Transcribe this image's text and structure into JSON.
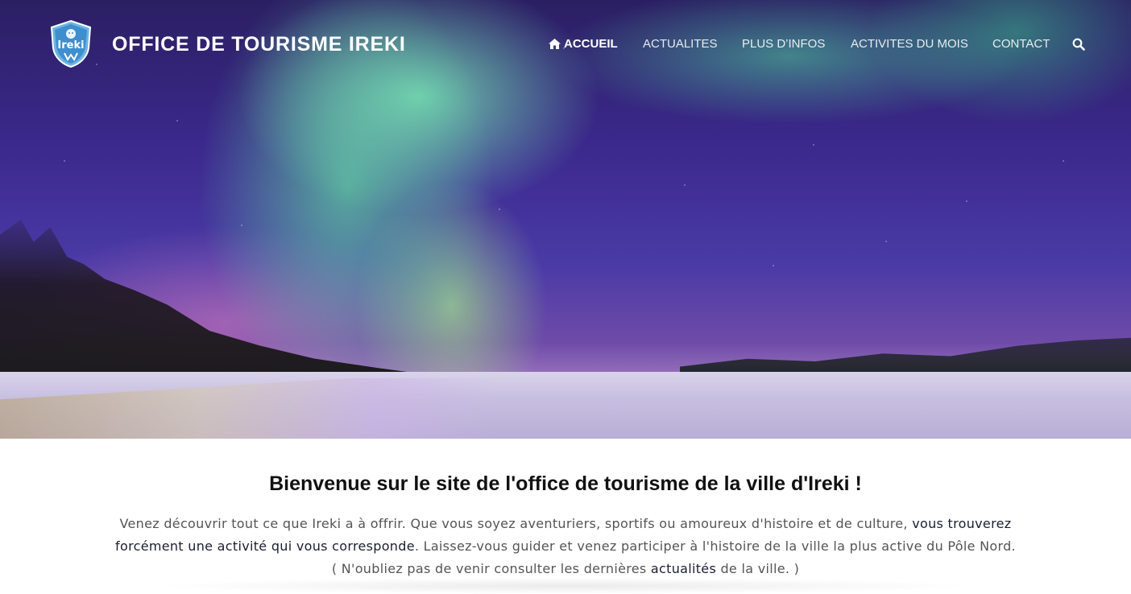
{
  "header": {
    "logo_text": "Ireki",
    "site_title": "OFFICE DE TOURISME IREKI"
  },
  "nav": {
    "items": [
      {
        "label": "ACCUEIL",
        "icon": "home-icon",
        "active": true
      },
      {
        "label": "ACTUALITES",
        "active": false
      },
      {
        "label": "PLUS D’INFOS",
        "active": false
      },
      {
        "label": "ACTIVITES DU MOIS",
        "active": false
      },
      {
        "label": "CONTACT",
        "active": false
      }
    ],
    "search_icon": "search-icon"
  },
  "hero": {
    "image": "aurora-borealis-snowy-landscape"
  },
  "main": {
    "title": "Bienvenue sur le site de l'office de tourisme de la ville d'Ireki !",
    "intro_part1": "Venez découvrir tout ce que Ireki a à offrir. Que vous soyez aventuriers, sportifs ou amoureux d'histoire et de culture, ",
    "intro_highlight": "vous trouverez forcément une activité qui vous corresponde",
    "intro_part2": ". Laissez-vous guider et venez participer à l'histoire de la ville la plus active du Pôle Nord.",
    "note_before": "( N'oubliez pas de venir consulter les dernières ",
    "note_link": "actualités",
    "note_after": " de la ville. )"
  },
  "colors": {
    "title_text": "#111111",
    "body_text": "#555555",
    "highlight_text": "#1d1d33",
    "nav_text": "#ffffff"
  }
}
